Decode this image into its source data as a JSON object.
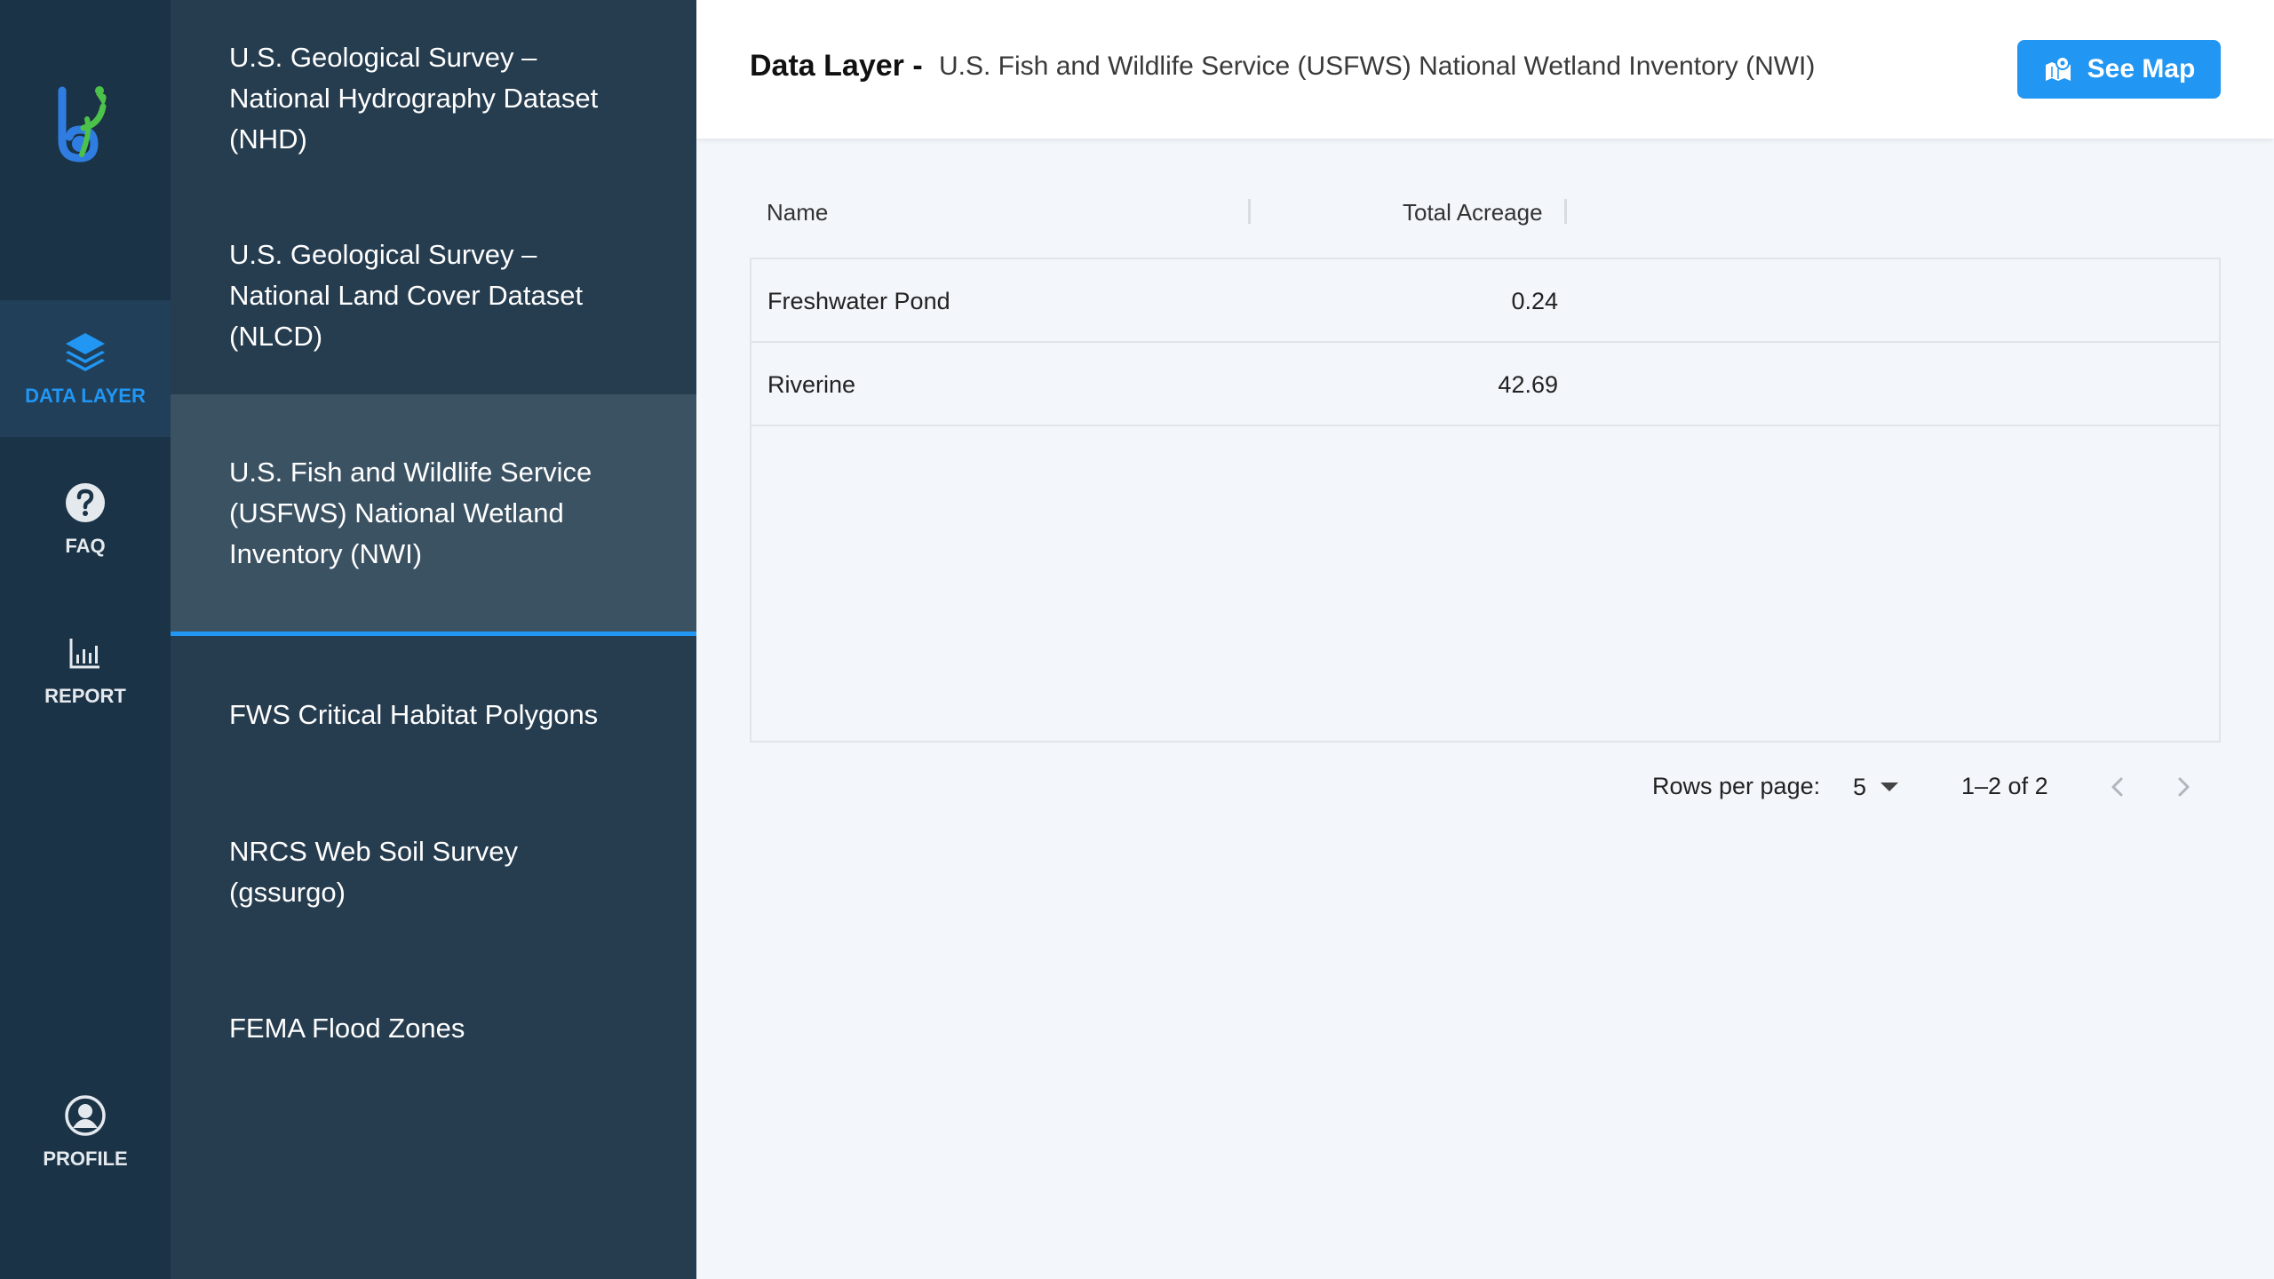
{
  "nav": {
    "items": [
      {
        "label": "DATA LAYER",
        "icon": "layers-icon"
      },
      {
        "label": "FAQ",
        "icon": "help-circle-icon"
      },
      {
        "label": "REPORT",
        "icon": "bar-chart-icon"
      },
      {
        "label": "PROFILE",
        "icon": "account-circle-icon"
      }
    ],
    "active": "DATA LAYER"
  },
  "layers": {
    "items": [
      {
        "label": "U.S. Geological Survey – National Hydrography Dataset (NHD)"
      },
      {
        "label": "U.S. Geological Survey – National Land Cover Dataset (NLCD)"
      },
      {
        "label": "U.S. Fish and Wildlife Service (USFWS) National Wetland Inventory (NWI)"
      },
      {
        "label": "FWS Critical Habitat Polygons"
      },
      {
        "label": "NRCS Web Soil Survey (gssurgo)"
      },
      {
        "label": "FEMA Flood Zones"
      }
    ],
    "selected_index": 2
  },
  "header": {
    "title_label": "Data Layer -",
    "title_value": "U.S. Fish and Wildlife Service (USFWS) National Wetland Inventory (NWI)",
    "see_map_label": "See Map"
  },
  "table": {
    "columns": [
      "Name",
      "Total Acreage"
    ],
    "rows": [
      {
        "name": "Freshwater Pond",
        "acreage": "0.24"
      },
      {
        "name": "Riverine",
        "acreage": "42.69"
      }
    ]
  },
  "pagination": {
    "rows_per_page_label": "Rows per page:",
    "rows_per_page": "5",
    "range": "1–2 of 2"
  },
  "colors": {
    "rail_bg": "#1b3346",
    "layers_bg": "#263c4f",
    "selected_bg": "#3b5263",
    "accent": "#2196f3",
    "logo_blue": "#2f7de1",
    "logo_green": "#4cc24a"
  }
}
